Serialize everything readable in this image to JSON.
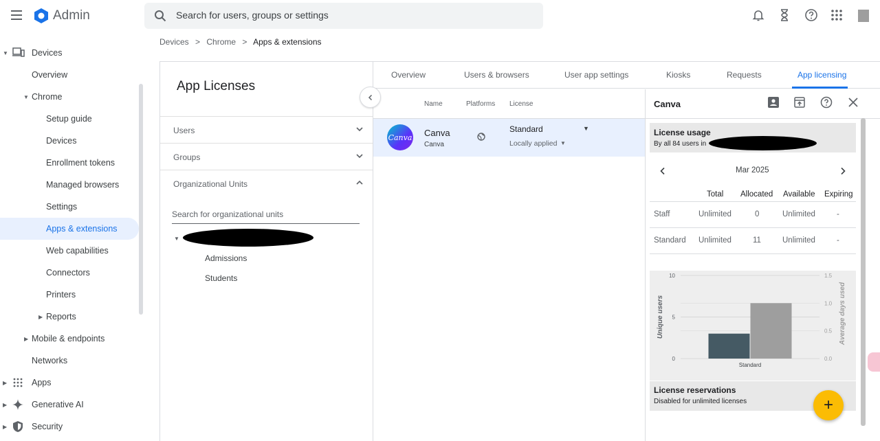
{
  "header": {
    "brand": "Admin",
    "search_placeholder": "Search for users, groups or settings"
  },
  "sidebar": {
    "devices": "Devices",
    "overview": "Overview",
    "chrome": "Chrome",
    "setup_guide": "Setup guide",
    "chrome_devices": "Devices",
    "enrollment_tokens": "Enrollment tokens",
    "managed_browsers": "Managed browsers",
    "settings": "Settings",
    "apps_extensions": "Apps & extensions",
    "web_capabilities": "Web capabilities",
    "connectors": "Connectors",
    "printers": "Printers",
    "reports": "Reports",
    "mobile_endpoints": "Mobile & endpoints",
    "networks": "Networks",
    "apps": "Apps",
    "generative_ai": "Generative AI",
    "security": "Security"
  },
  "breadcrumb": {
    "b1": "Devices",
    "b2": "Chrome",
    "b3": "Apps & extensions",
    "sep": ">"
  },
  "left_panel": {
    "title": "App Licenses",
    "users": "Users",
    "groups": "Groups",
    "org_units": "Organizational Units",
    "ou_search_placeholder": "Search for organizational units",
    "ou_children": [
      "Admissions",
      "Students"
    ]
  },
  "tabs": {
    "overview": "Overview",
    "users_browsers": "Users & browsers",
    "user_app_settings": "User app settings",
    "kiosks": "Kiosks",
    "requests": "Requests",
    "app_licensing": "App licensing"
  },
  "table": {
    "col_name": "Name",
    "col_platforms": "Platforms",
    "col_license": "License",
    "app_name": "Canva",
    "app_sub": "Canva",
    "logo_text": "Canva",
    "license": "Standard",
    "license_sub": "Locally applied"
  },
  "detail": {
    "title": "Canva",
    "usage_title": "License usage",
    "usage_sub": "By all 84 users in",
    "month": "Mar 2025",
    "columns": [
      "Total",
      "Allocated",
      "Available",
      "Expiring"
    ],
    "rows": [
      {
        "name": "Staff",
        "total": "Unlimited",
        "allocated": "0",
        "available": "Unlimited",
        "expiring": "-"
      },
      {
        "name": "Standard",
        "total": "Unlimited",
        "allocated": "11",
        "available": "Unlimited",
        "expiring": "-"
      }
    ],
    "reservations_title": "License reservations",
    "reservations_sub": "Disabled for unlimited licenses",
    "fab": "+"
  },
  "chart_data": {
    "type": "bar",
    "categories": [
      "Standard"
    ],
    "series": [
      {
        "axis": "left",
        "color": "#455a64",
        "values": [
          3
        ]
      },
      {
        "axis": "right",
        "color": "#9e9e9e",
        "values": [
          1.0
        ]
      }
    ],
    "ylabel": "Unique users",
    "y2label": "Average days used",
    "ylim": [
      0,
      10
    ],
    "y2lim": [
      0,
      1.5
    ],
    "yticks": [
      "10",
      "5",
      "0"
    ],
    "y2ticks": [
      "1.5",
      "1.0",
      "0.5",
      "0.0"
    ]
  }
}
